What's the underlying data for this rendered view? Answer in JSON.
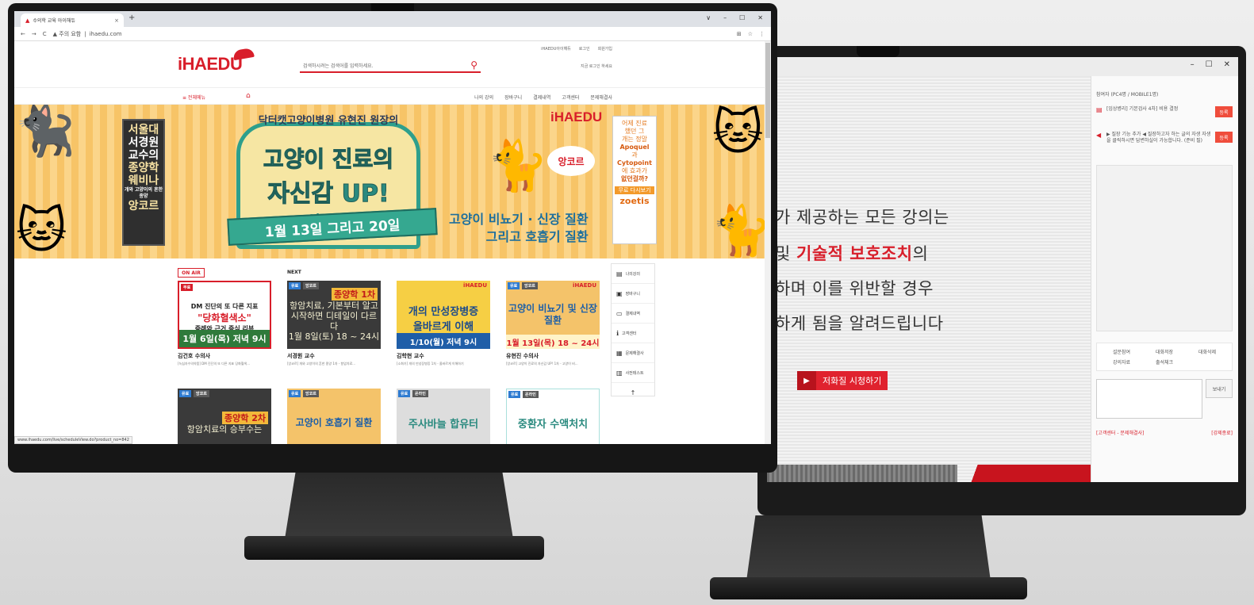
{
  "rear": {
    "window_controls": [
      "–",
      "☐",
      "✕"
    ],
    "video_lines": [
      {
        "pre": "",
        "red": "",
        "post": "가 제공하는 모든 강의는"
      },
      {
        "pre": "및 ",
        "red": "기술적 보호조치",
        "post": "의"
      },
      {
        "pre": "",
        "red": "",
        "post": "하며 이를 위반할 경우"
      },
      {
        "pre": "",
        "red": "",
        "post": "하게 됨을 알려드립니다"
      }
    ],
    "lowq_label": "저화질 시청하기",
    "side": {
      "header": "참여자 (PC4명 / MOBILE1명)",
      "row1_text": "[임상병리] 기본검사 4차] 비용 결정",
      "row1_button": "등록",
      "row2_text": "▶ 질장 기능 추가 ◀ 질장하고자 하는 글의 자생 자생을 클릭하시면 답변하실이 가능합니다. (준비 필)",
      "row2_button": "등록",
      "menu": [
        "설문참여",
        "대화저장",
        "대화삭제",
        "강의자료",
        "출석체크"
      ],
      "send_label": "보내기",
      "footer_left": "[고객센터 - 문제해결사]",
      "footer_right": "[강제종료]"
    }
  },
  "browser": {
    "tab_title": "수의학 교육 아이해듀",
    "tab_close": "×",
    "new_tab": "+",
    "controls": [
      "∨",
      "–",
      "☐",
      "✕"
    ],
    "nav_back": "←",
    "nav_forward": "→",
    "nav_reload": "C",
    "security_warning": "▲ 주의 요함",
    "url": "ihaedu.com",
    "status_url": "www.ihaedu.com/live/scheduleView.do?product_no=842"
  },
  "site": {
    "logo": "iHAEDU",
    "search_placeholder": "검색하시려는 검색어를 입력하세요.",
    "top_links": [
      "iHAEDU아이해듀",
      "로그인",
      "회원가입"
    ],
    "sub_link": "지금 로그인 하세요",
    "all_menu": "≡ 전체메뉴",
    "home_icon": "⌂",
    "nav_links": [
      "나의 강의",
      "장바구니",
      "결제내역",
      "고객센터",
      "문제해결사"
    ]
  },
  "banner": {
    "left_sign_lines": [
      "서울대",
      "서경원",
      "교수의",
      "종양학",
      "웨비나"
    ],
    "left_sign_small": "개와 고양이의 흔한 종양",
    "left_sign_last": "앙코르",
    "center_top": "닥터캣고양이병원 유현진 원장의",
    "center_line1": "고양이 진료의",
    "center_line2": "자신감 UP!",
    "center_line3": "앙코르",
    "ribbon": "1월 13일 그리고 20일",
    "logo": "iHAEDU",
    "bubble": "앙코르",
    "sub_line1": "고양이 비뇨기 · 신장 질환",
    "sub_line2": "그리고 호흡기 질환",
    "ad_lines": [
      "어제 진료",
      "했던 그",
      "개는 정말",
      "Apoquel",
      "과",
      "Cytopoint",
      "에 효과가",
      "없던걸까?"
    ],
    "ad_bar": "무료 다시보기",
    "ad_brand": "zoetis"
  },
  "lectures": {
    "onair_label": "ON AIR",
    "next_label": "NEXT",
    "cards": [
      {
        "badge": "무료",
        "l1": "DM 진단의 또 다른 지표",
        "l2": "\"당화혈색소\"",
        "l3": "증례와 근거 중심 리뷰",
        "bar": "1월 6일(목) 저녁 9시",
        "name": "김건호 수의사",
        "desc": "[녹십자수의약품] DM 진단의 또 다른 지표 당화혈색..."
      },
      {
        "badge": "유료",
        "badge2": "앙코르",
        "hd": "종양학 1차",
        "tx": "항암치료, 기본부터 알고 시작하면 디테일이 다르다",
        "bar": "1월 8일(토) 18 ~ 24시",
        "name": "서경원 교수",
        "desc": "[앙코르] 개와 고양이의 흔한 종양 1차 - 항암치료..."
      },
      {
        "lg": "iHAEDU",
        "a": "개의 만성장병증",
        "b": "올바르게 이해",
        "bar": "1/10(월) 저녁 9시",
        "name": "김학현 교수",
        "desc": "[소화기] 개의 만성장병증 1차 - 올바르게 이해하기"
      },
      {
        "badge": "유료",
        "badge2": "앙코르",
        "lg": "iHAEDU",
        "tx": "고양이 비뇨기 및 신장질환",
        "bar": "1월 13일(목) 18 ~ 24시",
        "name": "유현진 수의사",
        "desc": "[앙코르] 고양이 진료의 자신감 UP! 1차 - 고양이 비..."
      },
      {
        "badge": "유료",
        "badge2": "앙코르",
        "hd": "종양학 2차",
        "tx": "항암치료의 승부수는"
      },
      {
        "badge": "유료",
        "badge2": "앙코르",
        "tx": "고양이 호흡기 질환"
      },
      {
        "badge": "유료",
        "badge2": "온라인",
        "tx": "주사바늘 합유터"
      },
      {
        "badge": "유료",
        "badge2": "온라인",
        "tx": "중환자 수액처치"
      }
    ]
  },
  "quick_menu": [
    {
      "icon": "▤",
      "label": "나의강의"
    },
    {
      "icon": "▣",
      "label": "장바구니"
    },
    {
      "icon": "▭",
      "label": "결제내역"
    },
    {
      "icon": "ℹ",
      "label": "고객센터"
    },
    {
      "icon": "▦",
      "label": "문제해결사"
    },
    {
      "icon": "▥",
      "label": "사전테스트"
    },
    {
      "icon": "↑",
      "label": ""
    }
  ]
}
